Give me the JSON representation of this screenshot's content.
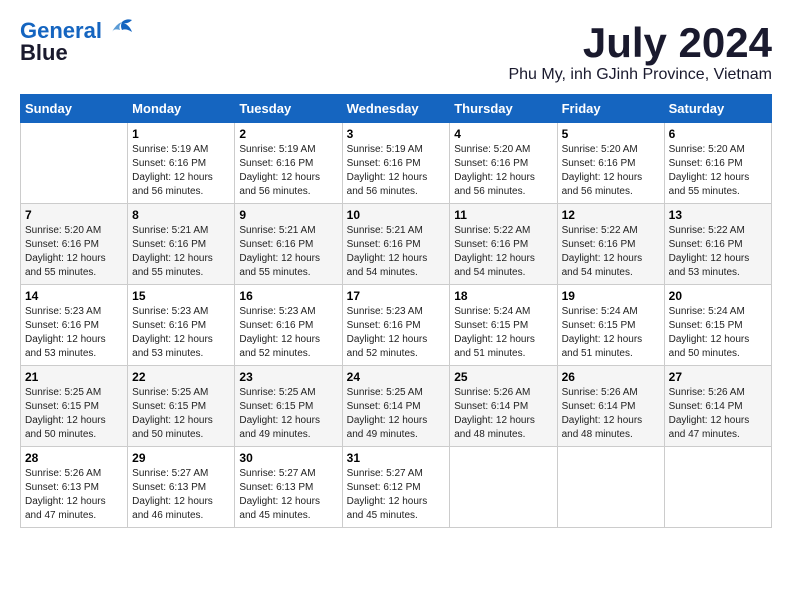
{
  "header": {
    "logo_line1": "General",
    "logo_line2": "Blue",
    "month_year": "July 2024",
    "location": "Phu My, inh GJinh Province, Vietnam"
  },
  "weekdays": [
    "Sunday",
    "Monday",
    "Tuesday",
    "Wednesday",
    "Thursday",
    "Friday",
    "Saturday"
  ],
  "weeks": [
    [
      {
        "day": "",
        "info": ""
      },
      {
        "day": "1",
        "info": "Sunrise: 5:19 AM\nSunset: 6:16 PM\nDaylight: 12 hours\nand 56 minutes."
      },
      {
        "day": "2",
        "info": "Sunrise: 5:19 AM\nSunset: 6:16 PM\nDaylight: 12 hours\nand 56 minutes."
      },
      {
        "day": "3",
        "info": "Sunrise: 5:19 AM\nSunset: 6:16 PM\nDaylight: 12 hours\nand 56 minutes."
      },
      {
        "day": "4",
        "info": "Sunrise: 5:20 AM\nSunset: 6:16 PM\nDaylight: 12 hours\nand 56 minutes."
      },
      {
        "day": "5",
        "info": "Sunrise: 5:20 AM\nSunset: 6:16 PM\nDaylight: 12 hours\nand 56 minutes."
      },
      {
        "day": "6",
        "info": "Sunrise: 5:20 AM\nSunset: 6:16 PM\nDaylight: 12 hours\nand 55 minutes."
      }
    ],
    [
      {
        "day": "7",
        "info": "Sunrise: 5:20 AM\nSunset: 6:16 PM\nDaylight: 12 hours\nand 55 minutes."
      },
      {
        "day": "8",
        "info": "Sunrise: 5:21 AM\nSunset: 6:16 PM\nDaylight: 12 hours\nand 55 minutes."
      },
      {
        "day": "9",
        "info": "Sunrise: 5:21 AM\nSunset: 6:16 PM\nDaylight: 12 hours\nand 55 minutes."
      },
      {
        "day": "10",
        "info": "Sunrise: 5:21 AM\nSunset: 6:16 PM\nDaylight: 12 hours\nand 54 minutes."
      },
      {
        "day": "11",
        "info": "Sunrise: 5:22 AM\nSunset: 6:16 PM\nDaylight: 12 hours\nand 54 minutes."
      },
      {
        "day": "12",
        "info": "Sunrise: 5:22 AM\nSunset: 6:16 PM\nDaylight: 12 hours\nand 54 minutes."
      },
      {
        "day": "13",
        "info": "Sunrise: 5:22 AM\nSunset: 6:16 PM\nDaylight: 12 hours\nand 53 minutes."
      }
    ],
    [
      {
        "day": "14",
        "info": "Sunrise: 5:23 AM\nSunset: 6:16 PM\nDaylight: 12 hours\nand 53 minutes."
      },
      {
        "day": "15",
        "info": "Sunrise: 5:23 AM\nSunset: 6:16 PM\nDaylight: 12 hours\nand 53 minutes."
      },
      {
        "day": "16",
        "info": "Sunrise: 5:23 AM\nSunset: 6:16 PM\nDaylight: 12 hours\nand 52 minutes."
      },
      {
        "day": "17",
        "info": "Sunrise: 5:23 AM\nSunset: 6:16 PM\nDaylight: 12 hours\nand 52 minutes."
      },
      {
        "day": "18",
        "info": "Sunrise: 5:24 AM\nSunset: 6:15 PM\nDaylight: 12 hours\nand 51 minutes."
      },
      {
        "day": "19",
        "info": "Sunrise: 5:24 AM\nSunset: 6:15 PM\nDaylight: 12 hours\nand 51 minutes."
      },
      {
        "day": "20",
        "info": "Sunrise: 5:24 AM\nSunset: 6:15 PM\nDaylight: 12 hours\nand 50 minutes."
      }
    ],
    [
      {
        "day": "21",
        "info": "Sunrise: 5:25 AM\nSunset: 6:15 PM\nDaylight: 12 hours\nand 50 minutes."
      },
      {
        "day": "22",
        "info": "Sunrise: 5:25 AM\nSunset: 6:15 PM\nDaylight: 12 hours\nand 50 minutes."
      },
      {
        "day": "23",
        "info": "Sunrise: 5:25 AM\nSunset: 6:15 PM\nDaylight: 12 hours\nand 49 minutes."
      },
      {
        "day": "24",
        "info": "Sunrise: 5:25 AM\nSunset: 6:14 PM\nDaylight: 12 hours\nand 49 minutes."
      },
      {
        "day": "25",
        "info": "Sunrise: 5:26 AM\nSunset: 6:14 PM\nDaylight: 12 hours\nand 48 minutes."
      },
      {
        "day": "26",
        "info": "Sunrise: 5:26 AM\nSunset: 6:14 PM\nDaylight: 12 hours\nand 48 minutes."
      },
      {
        "day": "27",
        "info": "Sunrise: 5:26 AM\nSunset: 6:14 PM\nDaylight: 12 hours\nand 47 minutes."
      }
    ],
    [
      {
        "day": "28",
        "info": "Sunrise: 5:26 AM\nSunset: 6:13 PM\nDaylight: 12 hours\nand 47 minutes."
      },
      {
        "day": "29",
        "info": "Sunrise: 5:27 AM\nSunset: 6:13 PM\nDaylight: 12 hours\nand 46 minutes."
      },
      {
        "day": "30",
        "info": "Sunrise: 5:27 AM\nSunset: 6:13 PM\nDaylight: 12 hours\nand 45 minutes."
      },
      {
        "day": "31",
        "info": "Sunrise: 5:27 AM\nSunset: 6:12 PM\nDaylight: 12 hours\nand 45 minutes."
      },
      {
        "day": "",
        "info": ""
      },
      {
        "day": "",
        "info": ""
      },
      {
        "day": "",
        "info": ""
      }
    ]
  ]
}
